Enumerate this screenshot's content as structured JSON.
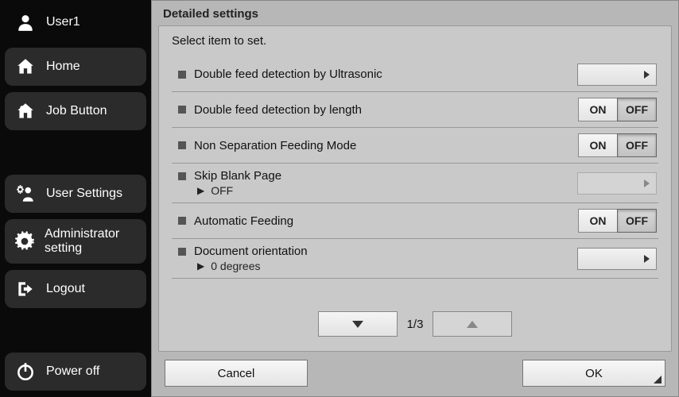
{
  "sidebar": {
    "user": "User1",
    "home": "Home",
    "job_button": "Job Button",
    "user_settings": "User Settings",
    "admin_setting": "Administrator setting",
    "logout": "Logout",
    "power_off": "Power off"
  },
  "header": {
    "title": "Detailed settings"
  },
  "instruction": "Select item to set.",
  "items": [
    {
      "label": "Double feed detection by Ultrasonic",
      "type": "dropdown",
      "sub": null,
      "value": "",
      "disabled": false
    },
    {
      "label": "Double feed detection by length",
      "type": "toggle",
      "on": "ON",
      "off": "OFF",
      "value": "OFF"
    },
    {
      "label": "Non Separation Feeding Mode",
      "type": "toggle",
      "on": "ON",
      "off": "OFF",
      "value": "OFF"
    },
    {
      "label": "Skip Blank Page",
      "type": "dropdown",
      "sub": "OFF",
      "value": "OFF",
      "disabled": true
    },
    {
      "label": "Automatic Feeding",
      "type": "toggle",
      "on": "ON",
      "off": "OFF",
      "value": "OFF"
    },
    {
      "label": "Document orientation",
      "type": "dropdown",
      "sub": "0 degrees",
      "value": "0 degrees",
      "disabled": false
    }
  ],
  "pager": {
    "current": 1,
    "total": 3,
    "label": "1/3"
  },
  "footer": {
    "cancel": "Cancel",
    "ok": "OK"
  }
}
